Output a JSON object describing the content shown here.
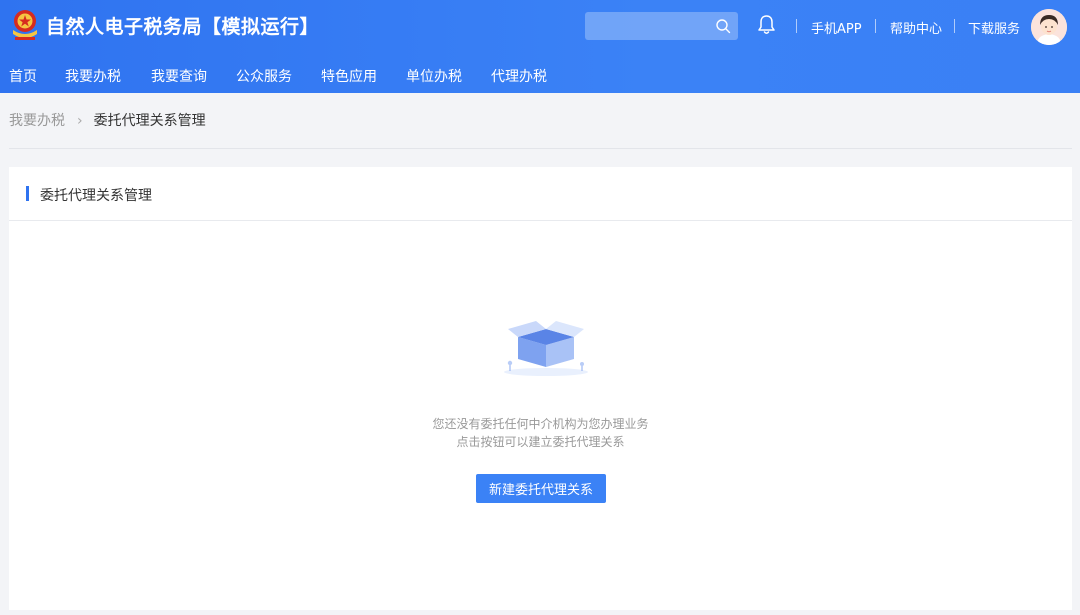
{
  "header": {
    "site_title": "自然人电子税务局【模拟运行】",
    "search_placeholder": "",
    "links": [
      "手机APP",
      "帮助中心",
      "下载服务"
    ]
  },
  "nav": {
    "items": [
      "首页",
      "我要办税",
      "我要查询",
      "公众服务",
      "特色应用",
      "单位办税",
      "代理办税"
    ]
  },
  "breadcrumb": {
    "parent": "我要办税",
    "separator": "›",
    "current": "委托代理关系管理"
  },
  "panel": {
    "title": "委托代理关系管理",
    "empty_line1": "您还没有委托任何中介机构为您办理业务",
    "empty_line2": "点击按钮可以建立委托代理关系",
    "create_button_label": "新建委托代理关系"
  },
  "icons": {
    "logo": "tax-emblem-icon",
    "search": "search-icon",
    "notification": "bell-icon",
    "user": "avatar",
    "empty": "empty-box-illustration"
  },
  "colors": {
    "brand_blue": "#2f73f0",
    "button_blue": "#3b82f6",
    "accent_bar": "#2f73f0"
  }
}
